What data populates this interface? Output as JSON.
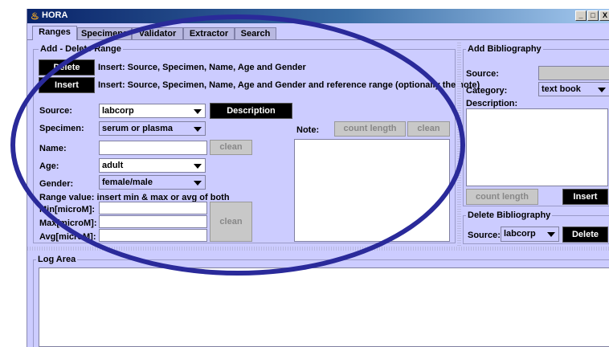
{
  "window": {
    "title": "HORA",
    "minimize": "_",
    "maximize": "□",
    "close": "X"
  },
  "tabs": [
    "Ranges",
    "Specimens",
    "Validator",
    "Extractor",
    "Search"
  ],
  "add_delete": {
    "title": "Add - Delete Range",
    "delete_label": "Delete",
    "delete_hint": "Insert: Source, Specimen, Name, Age and Gender",
    "insert_label": "Insert",
    "insert_hint": "Insert: Source, Specimen, Name, Age and Gender and reference range (optionally the note)",
    "source_label": "Source:",
    "source_value": "labcorp",
    "description_label": "Description",
    "specimen_label": "Specimen:",
    "specimen_value": "serum or plasma",
    "note_label": "Note:",
    "count_length_label": "count length",
    "clean_label": "clean",
    "name_label": "Name:",
    "name_value": "",
    "name_clean_label": "clean",
    "age_label": "Age:",
    "age_value": "adult",
    "gender_label": "Gender:",
    "gender_value": "female/male",
    "range_hint": "Range value: insert min & max or avg of both",
    "min_label": "Min[microM]:",
    "max_label": "Max[microM]:",
    "avg_label": "Avg[microM]:",
    "range_clean_label": "clean"
  },
  "bibliography": {
    "add_title": "Add Bibliography",
    "source_label": "Source:",
    "category_label": "Category:",
    "category_value": "text book",
    "description_label": "Description:",
    "count_length_label": "count length",
    "insert_label": "Insert",
    "delete_title": "Delete Bibliography",
    "delete_source_label": "Source:",
    "delete_source_value": "labcorp",
    "delete_label": "Delete"
  },
  "log": {
    "title": "Log Area"
  },
  "colors": {
    "panel": "#ccccff",
    "annotation": "#2a2a9a",
    "titlebar": "#0a246a"
  }
}
